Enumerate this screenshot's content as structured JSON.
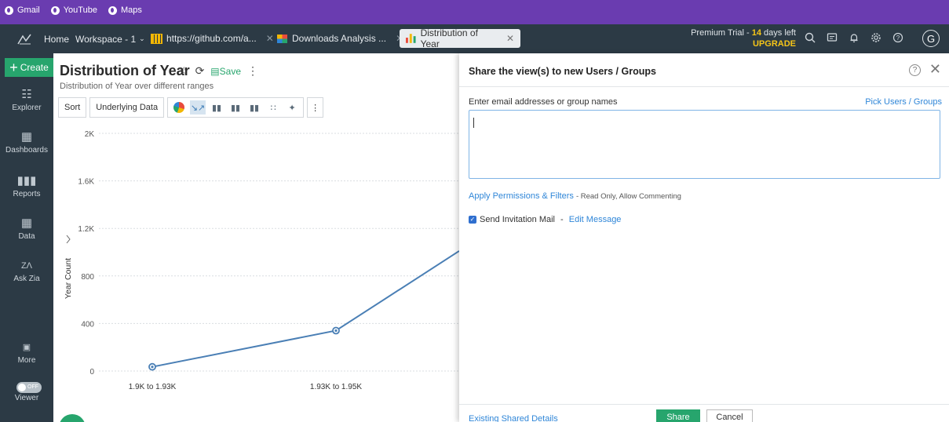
{
  "bookmarks": [
    {
      "label": "Gmail"
    },
    {
      "label": "YouTube"
    },
    {
      "label": "Maps"
    }
  ],
  "topbar": {
    "home": "Home",
    "workspace": "Workspace - 1",
    "tabs": [
      {
        "label": "https://github.com/a..."
      },
      {
        "label": "Downloads Analysis ..."
      },
      {
        "label": "Distribution of Year"
      }
    ],
    "trial_prefix": "Premium Trial - ",
    "trial_days": "14",
    "trial_suffix": " days left",
    "upgrade": "UPGRADE",
    "avatar": "G"
  },
  "sidebar": {
    "create": "Create",
    "items": [
      {
        "label": "Explorer"
      },
      {
        "label": "Dashboards"
      },
      {
        "label": "Reports"
      },
      {
        "label": "Data"
      },
      {
        "label": "Ask Zia"
      },
      {
        "label": "More"
      },
      {
        "label": "Viewer"
      }
    ],
    "toggle": "OFF"
  },
  "report": {
    "title": "Distribution of Year",
    "save": "Save",
    "subtitle": "Distribution of Year over different ranges",
    "sort": "Sort",
    "underlying": "Underlying Data"
  },
  "chart_data": {
    "type": "line",
    "ylabel": "Year Count",
    "ylim": [
      0,
      2000
    ],
    "yticks": [
      "0",
      "400",
      "800",
      "1.2K",
      "1.6K",
      "2K"
    ],
    "ytick_values": [
      0,
      400,
      800,
      1200,
      1600,
      2000
    ],
    "categories": [
      "1.9K to 1.93K",
      "1.93K to 1.95K"
    ],
    "values": [
      35,
      340
    ],
    "series_color": "#4a7fb5"
  },
  "panel": {
    "title": "Share the view(s) to new Users / Groups",
    "email_label": "Enter email addresses or group names",
    "pick_link": "Pick Users / Groups",
    "perm_link": "Apply Permissions & Filters",
    "perm_desc": "Read Only, Allow Commenting",
    "invite": "Send Invitation Mail",
    "edit_msg": "Edit Message",
    "existing": "Existing Shared Details",
    "share": "Share",
    "cancel": "Cancel"
  },
  "colors": {
    "accent": "#27a56d",
    "link": "#2f86d8",
    "bookmarks_bar": "#6a3cb0",
    "app_bar": "#2c3a45"
  }
}
